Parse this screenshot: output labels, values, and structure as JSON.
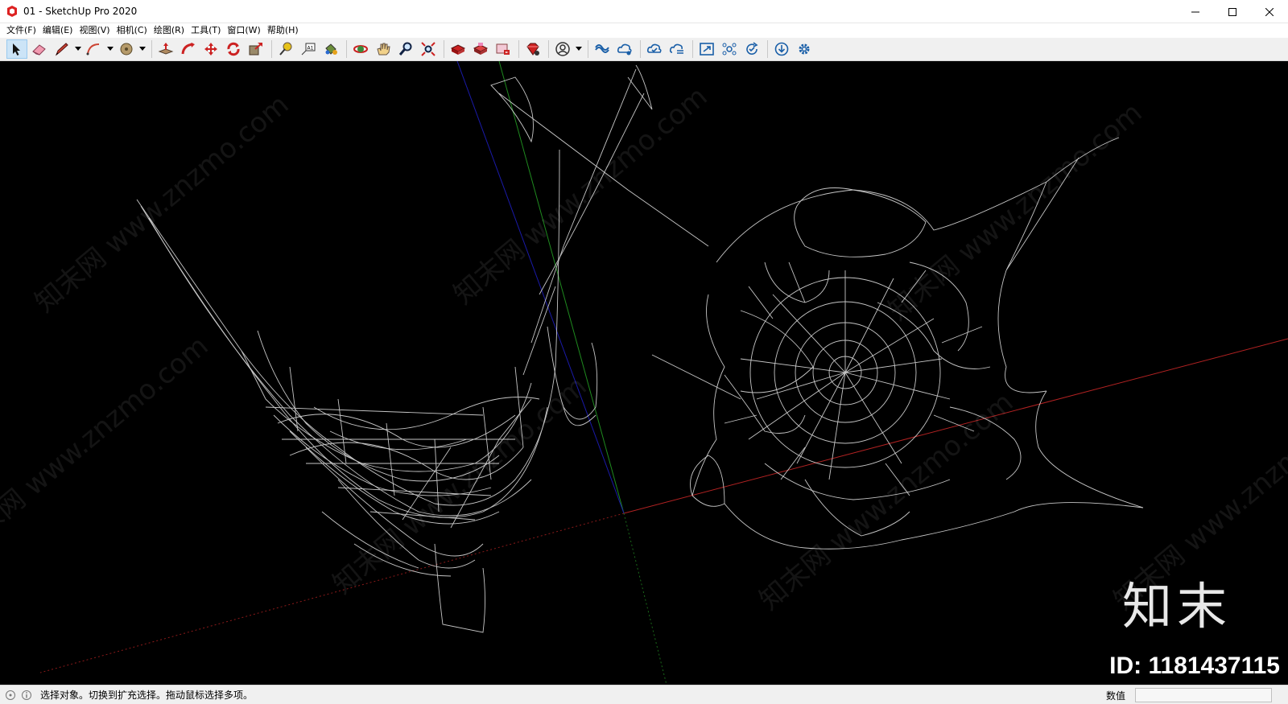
{
  "window": {
    "title": "01 - SketchUp Pro 2020"
  },
  "menu": [
    "文件(F)",
    "编辑(E)",
    "视图(V)",
    "相机(C)",
    "绘图(R)",
    "工具(T)",
    "窗口(W)",
    "帮助(H)"
  ],
  "toolbar": {
    "tools": [
      {
        "name": "select-tool",
        "icon": "arrow-cursor-icon",
        "active": true
      },
      {
        "name": "eraser-tool",
        "icon": "eraser-icon"
      },
      {
        "name": "line-tool",
        "icon": "pencil-icon",
        "dropdown": true
      },
      {
        "name": "arc-tool",
        "icon": "arc-icon",
        "dropdown": true
      },
      {
        "name": "shapes-tool",
        "icon": "circle-icon",
        "dropdown": true
      },
      {
        "name": "push-pull-tool",
        "icon": "push-pull-icon"
      },
      {
        "name": "follow-me-tool",
        "icon": "follow-me-icon"
      },
      {
        "name": "move-tool",
        "icon": "move-icon"
      },
      {
        "name": "rotate-tool",
        "icon": "rotate-icon"
      },
      {
        "name": "scale-tool",
        "icon": "scale-icon"
      },
      {
        "name": "tape-measure-tool",
        "icon": "tape-measure-icon"
      },
      {
        "name": "text-tool",
        "icon": "text-icon"
      },
      {
        "name": "paint-bucket-tool",
        "icon": "paint-bucket-icon"
      },
      {
        "name": "orbit-tool",
        "icon": "orbit-icon"
      },
      {
        "name": "pan-tool",
        "icon": "hand-icon"
      },
      {
        "name": "zoom-tool",
        "icon": "magnifier-icon"
      },
      {
        "name": "zoom-extents-tool",
        "icon": "zoom-extents-icon"
      },
      {
        "name": "3d-warehouse-button",
        "icon": "warehouse-icon"
      },
      {
        "name": "extension-warehouse-button",
        "icon": "extension-icon"
      },
      {
        "name": "layout-button",
        "icon": "layout-icon"
      },
      {
        "name": "extension-manager-button",
        "icon": "ruby-icon"
      },
      {
        "name": "account-button",
        "icon": "user-icon",
        "dropdown": true
      },
      {
        "name": "trimble-connect-button",
        "icon": "link-icon"
      },
      {
        "name": "cloud-upload-button",
        "icon": "cloud-icon"
      },
      {
        "name": "cloud-sync-button",
        "icon": "cloud-check-icon"
      },
      {
        "name": "cloud-list-button",
        "icon": "cloud-list-icon"
      },
      {
        "name": "frame-button",
        "icon": "frame-icon"
      },
      {
        "name": "network-button",
        "icon": "network-icon"
      },
      {
        "name": "refresh-button",
        "icon": "refresh-check-icon"
      },
      {
        "name": "download-button",
        "icon": "download-icon"
      },
      {
        "name": "settings-button",
        "icon": "gear-icon"
      }
    ]
  },
  "viewport": {
    "watermark": "知末网 www.znzmo.com",
    "brand": "知末",
    "id_label": "ID: 1181437115"
  },
  "status": {
    "message": "选择对象。切换到扩充选择。拖动鼠标选择多项。",
    "measure_label": "数值",
    "measure_value": ""
  },
  "colors": {
    "viewport_bg": "#000000",
    "axis_red": "#b22222",
    "axis_green": "#1f8a1f",
    "axis_blue": "#1a1aa8",
    "web_lines": "#dcdcdc"
  }
}
